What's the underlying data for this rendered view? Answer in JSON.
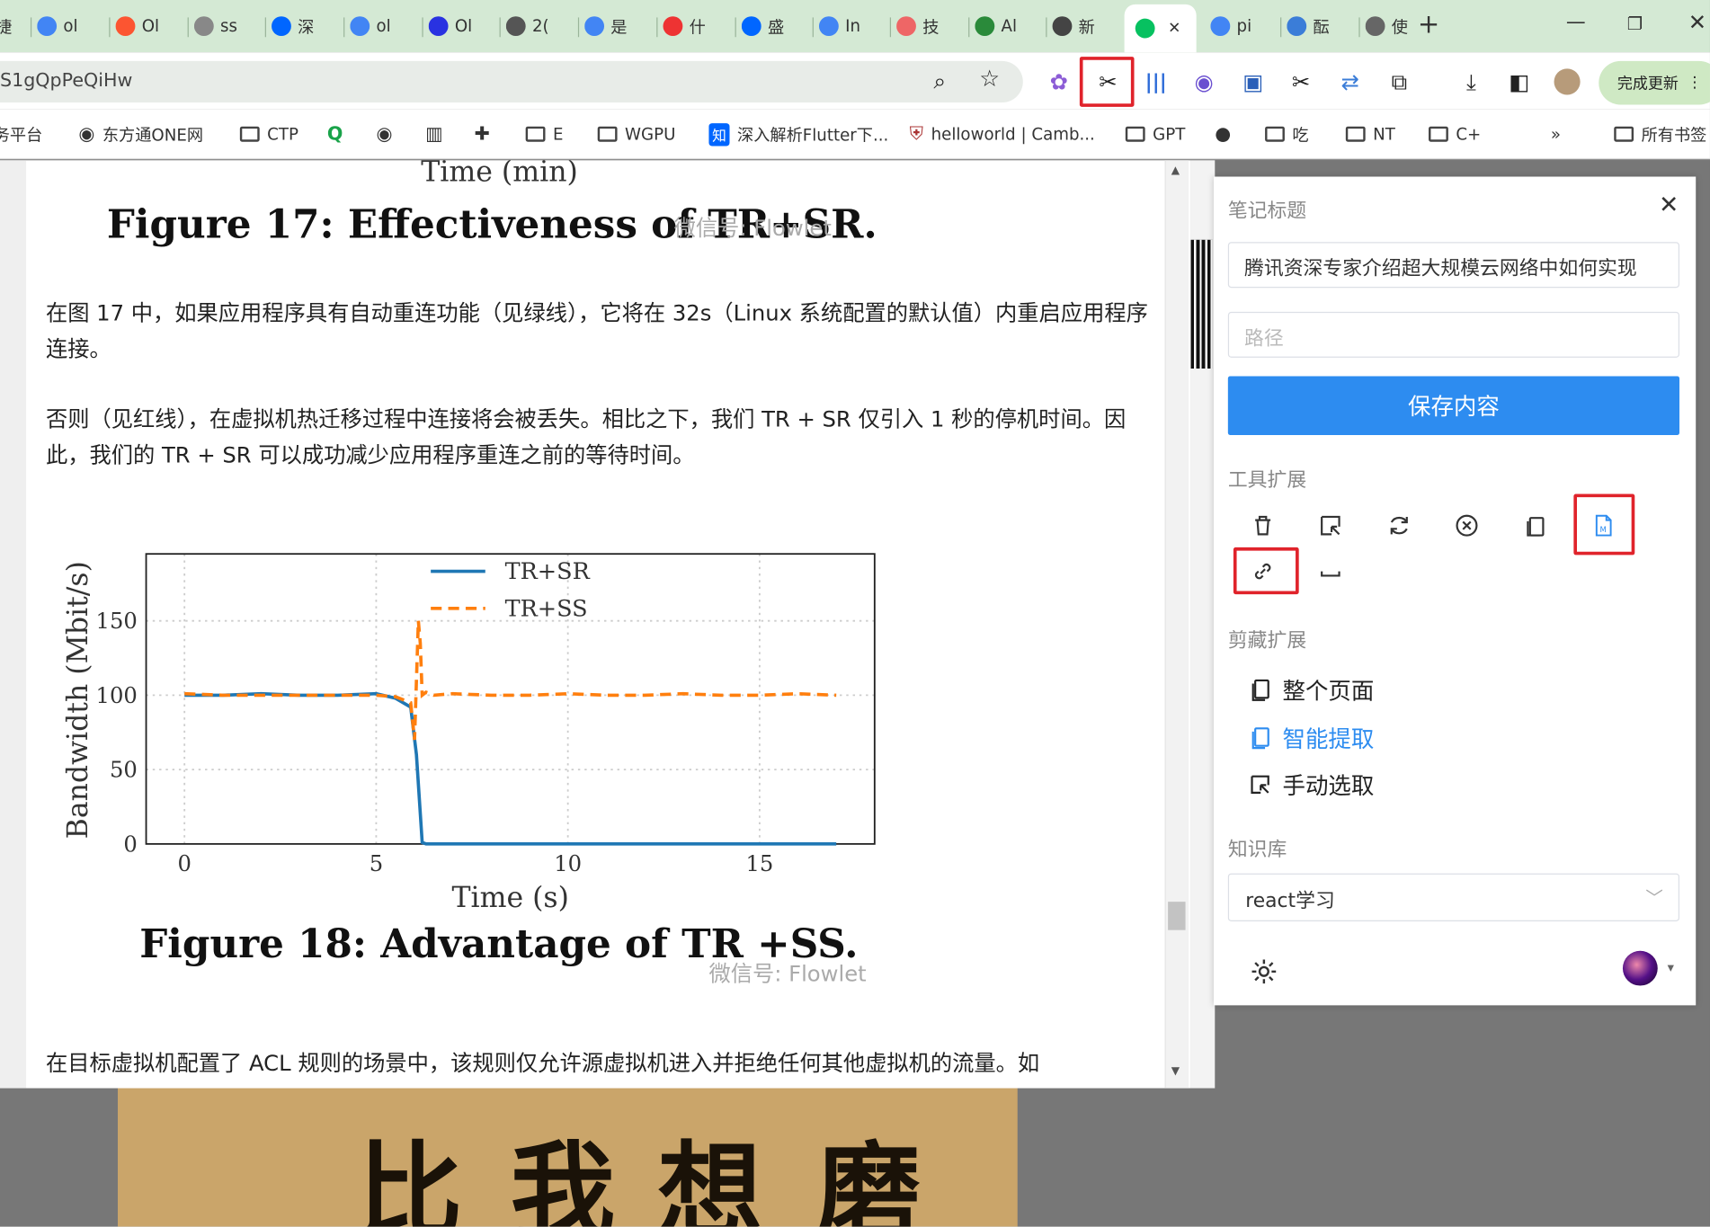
{
  "browser": {
    "tabs": [
      {
        "label": "捷",
        "icon": "web-icon",
        "color": "#4285f4"
      },
      {
        "label": "ol",
        "icon": "google-icon",
        "color": "#4285f4"
      },
      {
        "label": "Ol",
        "icon": "csdn-icon",
        "color": "#fc5531"
      },
      {
        "label": "ss",
        "icon": "gear-site-icon",
        "color": "#888888"
      },
      {
        "label": "深",
        "icon": "zhihu-icon",
        "color": "#0066ff"
      },
      {
        "label": "ol",
        "icon": "google-icon",
        "color": "#4285f4"
      },
      {
        "label": "Ol",
        "icon": "baidu-icon",
        "color": "#2932e1"
      },
      {
        "label": "2(",
        "icon": "openai-icon",
        "color": "#555555"
      },
      {
        "label": "是",
        "icon": "google-icon",
        "color": "#4285f4"
      },
      {
        "label": "什",
        "icon": "site-icon",
        "color": "#e33"
      },
      {
        "label": "盛",
        "icon": "zhihu-icon",
        "color": "#0066ff"
      },
      {
        "label": "In",
        "icon": "google-icon",
        "color": "#4285f4"
      },
      {
        "label": "技",
        "icon": "colorful-icon",
        "color": "#e66"
      },
      {
        "label": "Al",
        "icon": "leaf-icon",
        "color": "#2a8a3a"
      },
      {
        "label": "新",
        "icon": "chrome-icon",
        "color": "#444444"
      },
      {
        "label": "",
        "icon": "wechat-icon",
        "color": "#07c160",
        "active": true
      },
      {
        "label": "pi",
        "icon": "google-icon",
        "color": "#4285f4"
      },
      {
        "label": "酝",
        "icon": "doc-icon",
        "color": "#3b7dd8"
      },
      {
        "label": "使",
        "icon": "avatar-icon",
        "color": "#666666"
      }
    ],
    "url": "S1gQpPeQiHw",
    "update_label": "完成更新",
    "bookmarks": [
      {
        "label": "务平台",
        "icon": ""
      },
      {
        "label": "东方通ONE网",
        "icon": "globe-icon"
      },
      {
        "label": "CTP",
        "icon": "folder-icon"
      },
      {
        "label": "",
        "icon": "q-icon"
      },
      {
        "label": "",
        "icon": "globe-icon"
      },
      {
        "label": "",
        "icon": "book-icon"
      },
      {
        "label": "",
        "icon": "person-icon"
      },
      {
        "label": "E",
        "icon": "folder-icon"
      },
      {
        "label": "WGPU",
        "icon": "folder-icon"
      },
      {
        "label": "深入解析Flutter下...",
        "icon": "zhihu-icon"
      },
      {
        "label": "helloworld | Camb...",
        "icon": "shield-icon"
      },
      {
        "label": "GPT",
        "icon": "folder-icon"
      },
      {
        "label": "",
        "icon": "github-icon"
      },
      {
        "label": "吃",
        "icon": "folder-icon"
      },
      {
        "label": "NT",
        "icon": "folder-icon"
      },
      {
        "label": "C+",
        "icon": "folder-icon"
      },
      {
        "label": "»",
        "icon": ""
      },
      {
        "label": "所有书签",
        "icon": "folder-icon"
      }
    ]
  },
  "article": {
    "top_axis_label": "Time (min)",
    "fig17_caption": "Figure 17: Effectiveness of TR+SR.",
    "watermark": "微信号: Flowlet",
    "para1": "在图 17 中，如果应用程序具有自动重连功能（见绿线），它将在 32s（Linux 系统配置的默认值）内重启应用程序连接。",
    "para2": "否则（见红线），在虚拟机热迁移过程中连接将会被丢失。相比之下，我们 TR + SR 仅引入 1 秒的停机时间。因此，我们的 TR + SR 可以成功减少应用程序重连之前的等待时间。",
    "fig18_caption": "Figure 18: Advantage of TR +SS.",
    "para3": "在目标虚拟机配置了 ACL 规则的场景中，该规则仅允许源虚拟机进入并拒绝任何其他虚拟机的流量。如",
    "bg_calligraphy": "比我想磨"
  },
  "chart_data": {
    "type": "line",
    "xlabel": "Time (s)",
    "ylabel": "Bandwidth (Mbit/s)",
    "xlim": [
      -1,
      18
    ],
    "ylim": [
      0,
      195
    ],
    "xticks": [
      0,
      5,
      10,
      15
    ],
    "yticks": [
      0,
      50,
      100,
      150
    ],
    "grid": true,
    "legend_position": "top-center",
    "series": [
      {
        "name": "TR+SR",
        "color": "#1f77b4",
        "style": "solid",
        "x": [
          0,
          1,
          2,
          3,
          4,
          5,
          5.5,
          5.9,
          6.05,
          6.2,
          6.3,
          8,
          10,
          12,
          14,
          16,
          17
        ],
        "y": [
          100,
          100,
          101,
          100,
          100,
          101,
          98,
          92,
          60,
          1,
          0,
          0,
          0,
          0,
          0,
          0,
          0
        ]
      },
      {
        "name": "TR+SS",
        "color": "#ff7f0e",
        "style": "dashed",
        "x": [
          0,
          1,
          2,
          3,
          4,
          5,
          5.5,
          5.9,
          6.0,
          6.05,
          6.1,
          6.15,
          6.2,
          6.3,
          6.5,
          7,
          8,
          9,
          10,
          11,
          12,
          13,
          14,
          15,
          16,
          17
        ],
        "y": [
          101,
          100,
          100,
          100,
          100,
          100,
          99,
          95,
          70,
          110,
          150,
          135,
          100,
          102,
          100,
          101,
          100,
          100,
          101,
          100,
          100,
          101,
          100,
          100,
          101,
          100
        ]
      }
    ]
  },
  "panel": {
    "title_label": "笔记标题",
    "title_value": "腾讯资深专家介绍超大规模云网络中如何实现",
    "path_placeholder": "路径",
    "save_label": "保存内容",
    "tools_label": "工具扩展",
    "clip_label": "剪藏扩展",
    "clip_options": [
      "整个页面",
      "智能提取",
      "手动选取"
    ],
    "kb_label": "知识库",
    "kb_value": "react学习"
  },
  "colors": {
    "accent": "#2d8cf0",
    "highlight": "#e0232b",
    "tabbar": "#d4e9d4"
  }
}
